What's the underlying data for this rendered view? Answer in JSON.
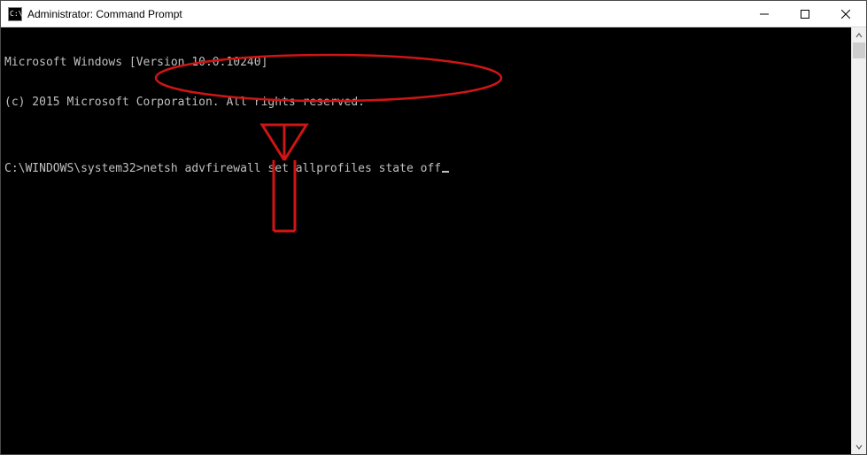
{
  "titlebar": {
    "title": "Administrator: Command Prompt",
    "minimize_label": "Minimize",
    "maximize_label": "Maximize",
    "close_label": "Close"
  },
  "console": {
    "line1": "Microsoft Windows [Version 10.0.10240]",
    "line2": "(c) 2015 Microsoft Corporation. All rights reserved.",
    "blank": "",
    "prompt_path": "C:\\WINDOWS\\system32>",
    "command": "netsh advfirewall set allprofiles state off"
  },
  "scrollbar": {
    "up_label": "Scroll up",
    "down_label": "Scroll down"
  },
  "annotation": {
    "shape": "ellipse-with-arrow",
    "color": "#cf1515"
  }
}
